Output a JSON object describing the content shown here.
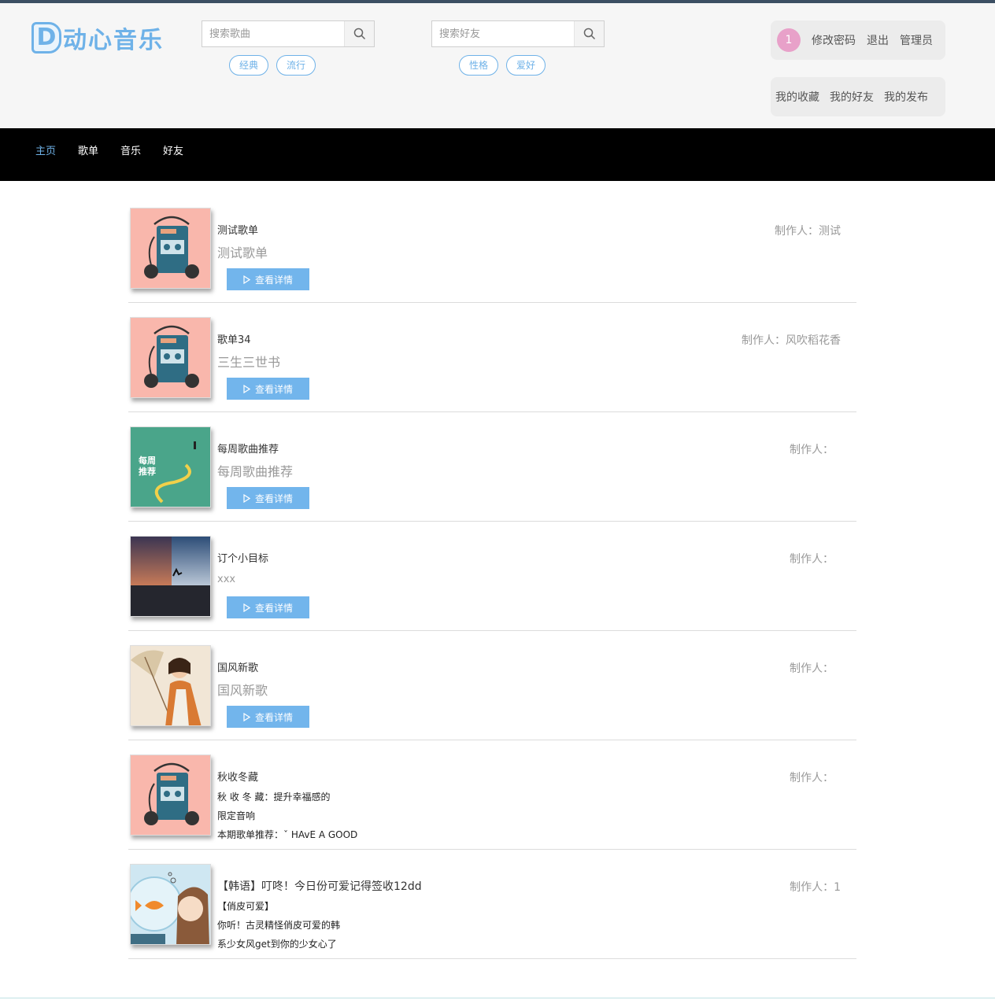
{
  "brand": {
    "logo_letter": "D",
    "name": "动心音乐",
    "color": "#6fb2e8"
  },
  "song_search": {
    "placeholder": "搜索歌曲",
    "value": "",
    "tags": [
      "经典",
      "流行"
    ]
  },
  "friend_search": {
    "placeholder": "搜索好友",
    "value": "",
    "tags": [
      "性格",
      "爱好"
    ]
  },
  "user": {
    "badge_count": "1",
    "change_password": "修改密码",
    "logout": "退出",
    "username": "管理员",
    "my_favorites": "我的收藏",
    "my_friends": "我的好友",
    "my_posts": "我的发布"
  },
  "nav": {
    "items": [
      "主页",
      "歌单",
      "音乐",
      "好友"
    ],
    "active": "主页"
  },
  "playlists": [
    {
      "title": "测试歌单",
      "subtitle": "测试歌单",
      "maker": "制作人：测试",
      "cover": "cassette-pink",
      "button": "查看详情"
    },
    {
      "title": "歌单34",
      "subtitle": "三生三世书",
      "maker": "制作人：风吹稻花香",
      "cover": "cassette-pink",
      "button": "查看详情"
    },
    {
      "title": "每周歌曲推荐",
      "subtitle": "每周歌曲推荐",
      "maker": "制作人：",
      "cover": "weekly-green",
      "cover_text": "每周推荐",
      "button": "查看详情"
    },
    {
      "title": "订个小目标",
      "subtitle": "xxx",
      "maker": "制作人：",
      "cover": "sunset-runner",
      "button": "查看详情"
    },
    {
      "title": "国风新歌",
      "subtitle": "国风新歌",
      "maker": "制作人：",
      "cover": "guofeng-girl",
      "button": "查看详情"
    },
    {
      "title": "秋收冬藏",
      "desc": [
        "秋 收 冬 藏：提升幸福感的",
        "限定音响",
        "本期歌单推荐：ˇ HAvE A GOOD"
      ],
      "maker": "制作人：",
      "cover": "cassette-pink"
    },
    {
      "title": "【韩语】叮咚！今日份可爱记得签收12dd",
      "desc": [
        "【俏皮可爱】",
        "你听！古灵精怪俏皮可爱的韩",
        "系少女风get到你的少女心了"
      ],
      "maker": "制作人：1",
      "cover": "goldfish-girl"
    }
  ],
  "colors": {
    "accent": "#6fb2e8",
    "nav_bg": "#000000",
    "header_bg": "#f6f6f6",
    "badge": "#e8a1c9"
  }
}
